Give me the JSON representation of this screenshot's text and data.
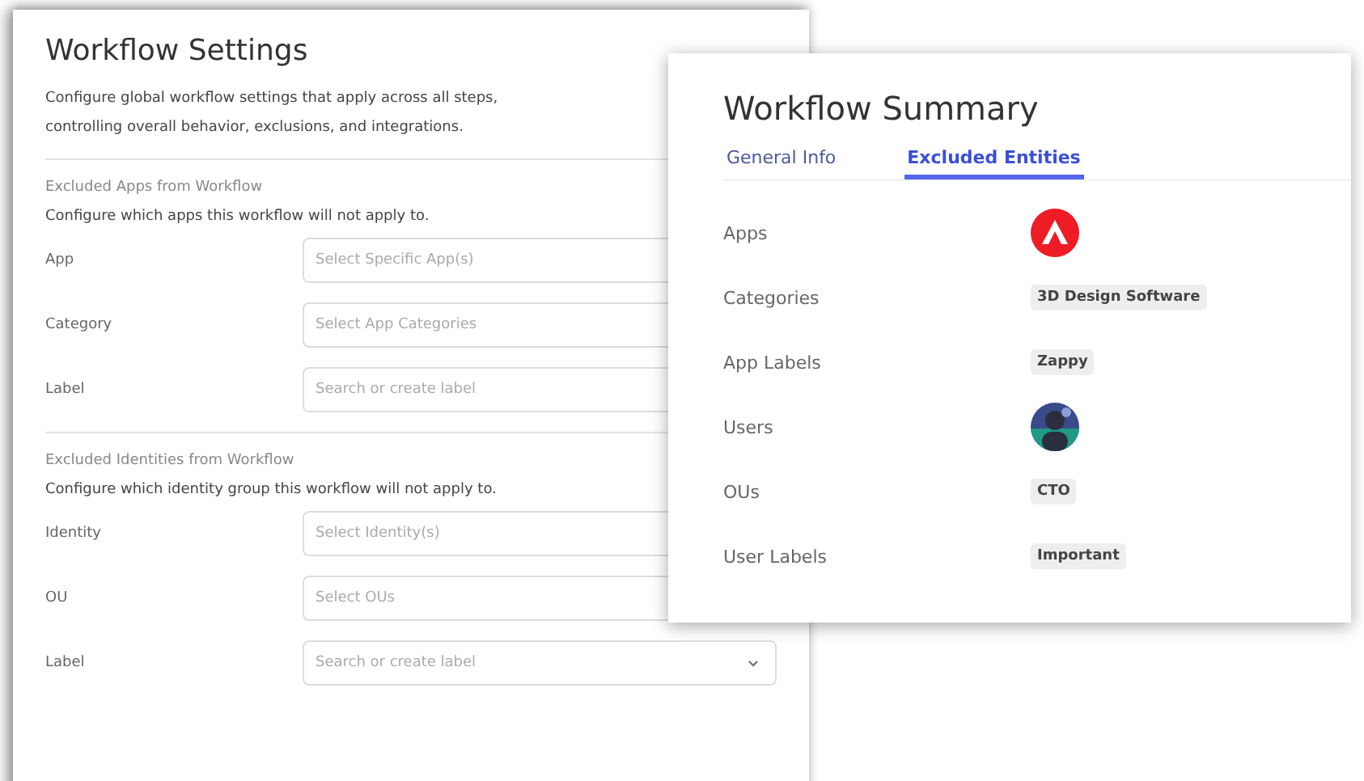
{
  "settings": {
    "title": "Workflow Settings",
    "description": "Configure global workflow settings that apply across all steps, controlling overall behavior, exclusions, and integrations.",
    "sections": [
      {
        "heading": "Excluded Apps from Workflow",
        "subheading": "Configure which apps this workflow will not apply to.",
        "fields": [
          {
            "label": "App",
            "placeholder": "Select Specific App(s)"
          },
          {
            "label": "Category",
            "placeholder": "Select App Categories"
          },
          {
            "label": "Label",
            "placeholder": "Search or create label"
          }
        ]
      },
      {
        "heading": "Excluded Identities from Workflow",
        "subheading": "Configure which identity group this workflow will not apply to.",
        "fields": [
          {
            "label": "Identity",
            "placeholder": "Select Identity(s)"
          },
          {
            "label": "OU",
            "placeholder": "Select OUs"
          },
          {
            "label": "Label",
            "placeholder": "Search or create label"
          }
        ]
      }
    ]
  },
  "summary": {
    "title": "Workflow Summary",
    "tabs": [
      {
        "label": "General Info",
        "selected": false
      },
      {
        "label": "Excluded Entities",
        "selected": true
      }
    ],
    "rows": [
      {
        "label": "Apps",
        "kind": "app-icon"
      },
      {
        "label": "Categories",
        "kind": "tag",
        "value": "3D Design Software"
      },
      {
        "label": "App Labels",
        "kind": "tag",
        "value": "Zappy"
      },
      {
        "label": "Users",
        "kind": "avatar"
      },
      {
        "label": "OUs",
        "kind": "tag",
        "value": "CTO"
      },
      {
        "label": "User Labels",
        "kind": "tag",
        "value": "Important"
      }
    ]
  }
}
